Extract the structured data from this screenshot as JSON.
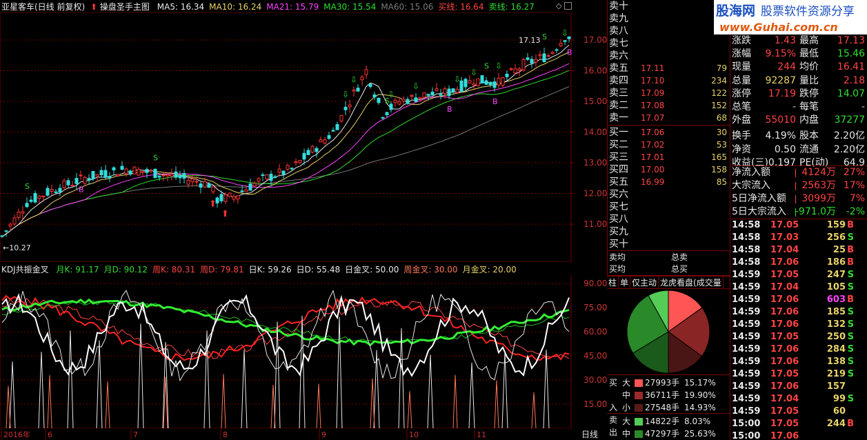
{
  "header": {
    "title": "亚星客车(日线 前复权)",
    "main_chart": "操盘圣手主图",
    "ma": [
      {
        "label": "MA5: 16.34",
        "color": "#e8e8e8"
      },
      {
        "label": "MA10: 16.24",
        "color": "#e8d26a"
      },
      {
        "label": "MA21: 15.79",
        "color": "#ff44ff"
      },
      {
        "label": "MA30: 15.54",
        "color": "#33dd33"
      },
      {
        "label": "MA60: 15.06",
        "color": "#7a7a7a"
      },
      {
        "label": "买线: 16.64",
        "color": "#ff4444"
      },
      {
        "label": "卖线: 16.27",
        "color": "#33dd33"
      }
    ]
  },
  "main_axis": {
    "ticks": [
      "17.00",
      "16.00",
      "15.00",
      "14.00",
      "13.00",
      "12.00",
      "11.00"
    ]
  },
  "main_annotations": {
    "high": "17.13",
    "low": "10.27",
    "buy_signal": "B",
    "sell_signal": "S"
  },
  "kdj": {
    "title": "KDJ共振金叉",
    "params": [
      {
        "label": "月K: 91.17",
        "color": "#33dd33"
      },
      {
        "label": "月D: 90.12",
        "color": "#33dd33"
      },
      {
        "label": "周K: 80.31",
        "color": "#ff4444"
      },
      {
        "label": "周D: 79.81",
        "color": "#ff4444"
      },
      {
        "label": "日K: 59.26",
        "color": "#e8e8e8"
      },
      {
        "label": "日D: 55.48",
        "color": "#e8e8e8"
      },
      {
        "label": "日金叉: 50.00",
        "color": "#e8e8e8"
      },
      {
        "label": "周金叉: 30.00",
        "color": "#ff7755"
      },
      {
        "label": "月金叉: 20.00",
        "color": "#e8d26a"
      }
    ],
    "ticks": [
      "90.00",
      "75.00",
      "60.00",
      "45.00",
      "30.00",
      "15.00"
    ]
  },
  "x_axis": {
    "labels": [
      "2016年",
      "6",
      "7",
      "8",
      "9",
      "10",
      "11"
    ],
    "period": "日线"
  },
  "order_book": {
    "sell": [
      {
        "label": "卖十",
        "price": "",
        "vol": ""
      },
      {
        "label": "卖九",
        "price": "",
        "vol": ""
      },
      {
        "label": "卖八",
        "price": "",
        "vol": ""
      },
      {
        "label": "卖七",
        "price": "",
        "vol": ""
      },
      {
        "label": "卖六",
        "price": "",
        "vol": ""
      },
      {
        "label": "卖五",
        "price": "17.11",
        "vol": "79"
      },
      {
        "label": "卖四",
        "price": "17.10",
        "vol": "234"
      },
      {
        "label": "卖三",
        "price": "17.09",
        "vol": "122"
      },
      {
        "label": "卖二",
        "price": "17.08",
        "vol": "152"
      },
      {
        "label": "卖一",
        "price": "17.07",
        "vol": "68"
      }
    ],
    "buy": [
      {
        "label": "买一",
        "price": "17.06",
        "vol": "30"
      },
      {
        "label": "买二",
        "price": "17.02",
        "vol": "53"
      },
      {
        "label": "买三",
        "price": "17.01",
        "vol": "165"
      },
      {
        "label": "买四",
        "price": "17.00",
        "vol": "158"
      },
      {
        "label": "买五",
        "price": "16.99",
        "vol": "85"
      },
      {
        "label": "买六",
        "price": "",
        "vol": ""
      },
      {
        "label": "买七",
        "price": "",
        "vol": ""
      },
      {
        "label": "买八",
        "price": "",
        "vol": ""
      },
      {
        "label": "买九",
        "price": "",
        "vol": ""
      },
      {
        "label": "买十",
        "price": "",
        "vol": ""
      }
    ],
    "sell_avg": "卖均",
    "sell_total": "总卖",
    "buy_avg": "买均",
    "buy_total": "总买"
  },
  "tabs": [
    "柱",
    "单",
    "仅主动",
    "龙虎看盘(成交量"
  ],
  "dist": {
    "buy_label": [
      "买",
      "入"
    ],
    "sell_label": [
      "卖",
      "出"
    ],
    "rows": [
      {
        "side": "buy",
        "size": "大",
        "vol": "27993手",
        "pct": "15.17%",
        "color": "#ff5555"
      },
      {
        "side": "buy",
        "size": "中",
        "vol": "36711手",
        "pct": "19.90%",
        "color": "#9a2a2a"
      },
      {
        "side": "buy",
        "size": "小",
        "vol": "27548手",
        "pct": "14.93%",
        "color": "#5a1a1a"
      },
      {
        "side": "sell",
        "size": "大",
        "vol": "14822手",
        "pct": "8.03%",
        "color": "#55cc55"
      },
      {
        "side": "sell",
        "size": "中",
        "vol": "47297手",
        "pct": "25.63%",
        "color": "#2a8a2a"
      }
    ]
  },
  "chart_data": {
    "type": "pie",
    "slices": [
      {
        "name": "买大",
        "value": 15.17,
        "color": "#ff5555"
      },
      {
        "name": "买中",
        "value": 19.9,
        "color": "#8a2525"
      },
      {
        "name": "买小",
        "value": 14.93,
        "color": "#4a1515"
      },
      {
        "name": "卖小",
        "value": 16.37,
        "color": "#1a5a1a"
      },
      {
        "name": "卖中",
        "value": 25.63,
        "color": "#2a8a2a"
      },
      {
        "name": "卖大",
        "value": 8.03,
        "color": "#55cc55"
      }
    ]
  },
  "logo": {
    "brand": "股海网",
    "slogan": "股票软件资源分享",
    "url": "www.Guhai.com.cn"
  },
  "quote": [
    {
      "l1": "涨跌",
      "v1": "1.43",
      "c1": "#ff4444",
      "l2": "最高",
      "v2": "17.13",
      "c2": "#ff4444"
    },
    {
      "l1": "涨幅",
      "v1": "9.15%",
      "c1": "#ff4444",
      "l2": "最低",
      "v2": "15.46",
      "c2": "#33dd33"
    },
    {
      "l1": "现量",
      "v1": "244",
      "c1": "#ff4444",
      "l2": "均价",
      "v2": "16.41",
      "c2": "#ff4444"
    },
    {
      "l1": "总量",
      "v1": "92287",
      "c1": "#e8d26a",
      "l2": "量比",
      "v2": "2.18",
      "c2": "#ff4444"
    },
    {
      "l1": "涨停",
      "v1": "17.19",
      "c1": "#ff4444",
      "l2": "跌停",
      "v2": "14.07",
      "c2": "#33dd33"
    },
    {
      "l1": "总笔",
      "v1": "-",
      "c1": "#c0c0c0",
      "l2": "每笔",
      "v2": "-",
      "c2": "#c0c0c0"
    },
    {
      "l1": "外盘",
      "v1": "55010",
      "c1": "#ff4444",
      "l2": "内盘",
      "v2": "37277",
      "c2": "#33dd33"
    },
    {
      "l1": "换手",
      "v1": "4.19%",
      "c1": "#e8e8e8",
      "l2": "股本",
      "v2": "2.20亿",
      "c2": "#e8e8e8"
    },
    {
      "l1": "净资",
      "v1": "0.50",
      "c1": "#e8e8e8",
      "l2": "流通",
      "v2": "2.20亿",
      "c2": "#e8e8e8"
    },
    {
      "l1": "收益(三)",
      "v1": "0.197",
      "c1": "#e8e8e8",
      "l2": "PE(动)",
      "v2": "64.9",
      "c2": "#e8e8e8"
    }
  ],
  "flows": [
    {
      "label": "净流入额",
      "value": "4124万",
      "pct": "27%",
      "color": "#ff4444"
    },
    {
      "label": "大宗流入",
      "value": "2563万",
      "pct": "17%",
      "color": "#ff4444"
    },
    {
      "label": "5日净流入额",
      "value": "3099万",
      "pct": "7%",
      "color": "#ff4444"
    },
    {
      "label": "5日大宗流入",
      "value": "-971.0万",
      "pct": "-2%",
      "color": "#33dd33"
    }
  ],
  "ticks": [
    {
      "t": "14:58",
      "p": "17.05",
      "v": "159",
      "s": "B"
    },
    {
      "t": "14:58",
      "p": "17.03",
      "v": "256",
      "s": "S"
    },
    {
      "t": "14:58",
      "p": "17.04",
      "v": "25",
      "s": "B"
    },
    {
      "t": "14:58",
      "p": "17.06",
      "v": "186",
      "s": "B"
    },
    {
      "t": "14:59",
      "p": "17.05",
      "v": "247",
      "s": "S"
    },
    {
      "t": "14:59",
      "p": "17.04",
      "v": "105",
      "s": "S"
    },
    {
      "t": "14:59",
      "p": "17.06",
      "v": "603",
      "s": "B"
    },
    {
      "t": "14:59",
      "p": "17.06",
      "v": "185",
      "s": "S"
    },
    {
      "t": "14:59",
      "p": "17.06",
      "v": "132",
      "s": "S"
    },
    {
      "t": "14:59",
      "p": "17.05",
      "v": "250",
      "s": "S"
    },
    {
      "t": "14:59",
      "p": "17.06",
      "v": "284",
      "s": "S"
    },
    {
      "t": "14:59",
      "p": "17.06",
      "v": "138",
      "s": "S"
    },
    {
      "t": "14:59",
      "p": "17.05",
      "v": "219",
      "s": "S"
    },
    {
      "t": "14:59",
      "p": "17.06",
      "v": "157",
      "s": ""
    },
    {
      "t": "14:59",
      "p": "17.04",
      "v": "99",
      "s": "S"
    },
    {
      "t": "14:59",
      "p": "17.05",
      "v": "60",
      "s": ""
    },
    {
      "t": "15:00",
      "p": "17.05",
      "v": "244",
      "s": "B"
    },
    {
      "t": "15:00",
      "p": "17.06",
      "v": "",
      "s": ""
    }
  ]
}
